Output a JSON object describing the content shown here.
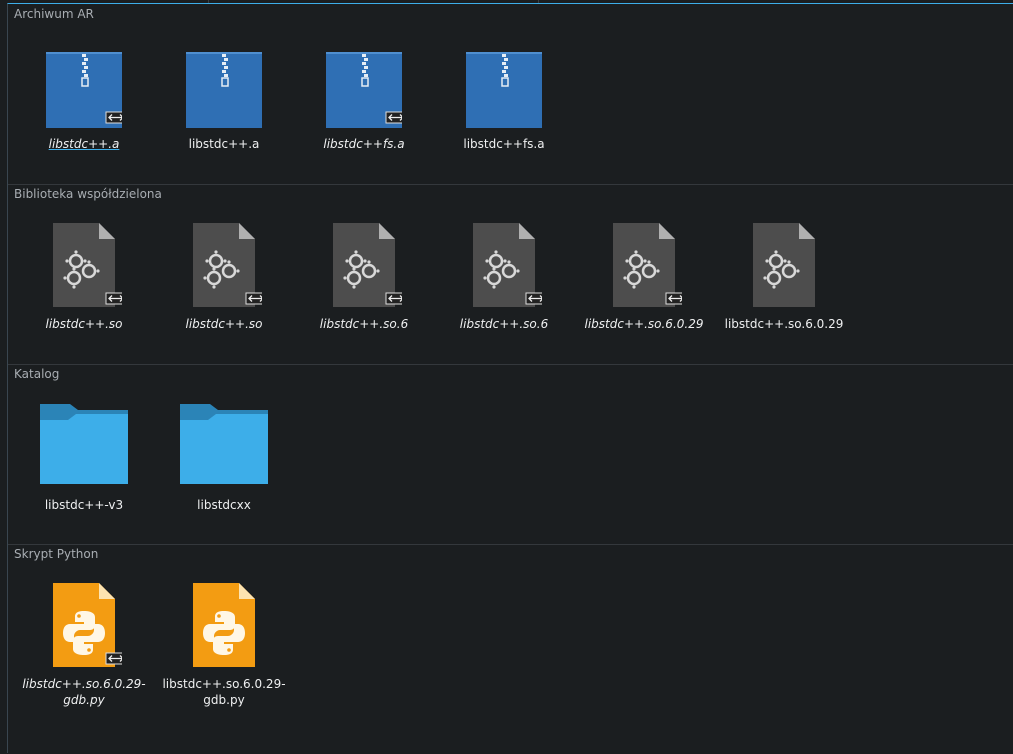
{
  "groups": [
    {
      "title": "Archiwum AR",
      "icon": "archive-icon",
      "items": [
        {
          "name": "libstdc++.a",
          "italic": true,
          "link": true,
          "underline": true
        },
        {
          "name": "libstdc++.a",
          "italic": false,
          "link": false
        },
        {
          "name": "libstdc++fs.a",
          "italic": true,
          "link": true
        },
        {
          "name": "libstdc++fs.a",
          "italic": false,
          "link": false
        }
      ]
    },
    {
      "title": "Biblioteka współdzielona",
      "icon": "shared-library-icon",
      "items": [
        {
          "name": "libstdc++.so",
          "italic": true,
          "link": true
        },
        {
          "name": "libstdc++.so",
          "italic": true,
          "link": true
        },
        {
          "name": "libstdc++.so.6",
          "italic": true,
          "link": true
        },
        {
          "name": "libstdc++.so.6",
          "italic": true,
          "link": true
        },
        {
          "name": "libstdc++.so.6.0.29",
          "italic": true,
          "link": true
        },
        {
          "name": "libstdc++.so.6.0.29",
          "italic": false,
          "link": false
        }
      ]
    },
    {
      "title": "Katalog",
      "icon": "folder-icon",
      "items": [
        {
          "name": "libstdc++-v3",
          "italic": false,
          "link": false
        },
        {
          "name": "libstdcxx",
          "italic": false,
          "link": false
        }
      ]
    },
    {
      "title": "Skrypt Python",
      "icon": "python-script-icon",
      "items": [
        {
          "name": "libstdc++.so.6.0.29-gdb.py",
          "line1": "libstdc++.so.6.0.29-",
          "line2": "gdb.py",
          "italic": true,
          "link": true
        },
        {
          "name": "libstdc++.so.6.0.29-gdb.py",
          "line1": "libstdc++.so.6.0.29-",
          "line2": "gdb.py",
          "italic": false,
          "link": false
        }
      ]
    }
  ],
  "colors": {
    "background": "#1b1e20",
    "text": "#eff0f1",
    "group_title": "#a8adb2",
    "accent": "#3daee9",
    "archive": "#2f6fb4",
    "library": "#4d4d4d",
    "folder": "#3daee9",
    "python": "#f39c12"
  }
}
